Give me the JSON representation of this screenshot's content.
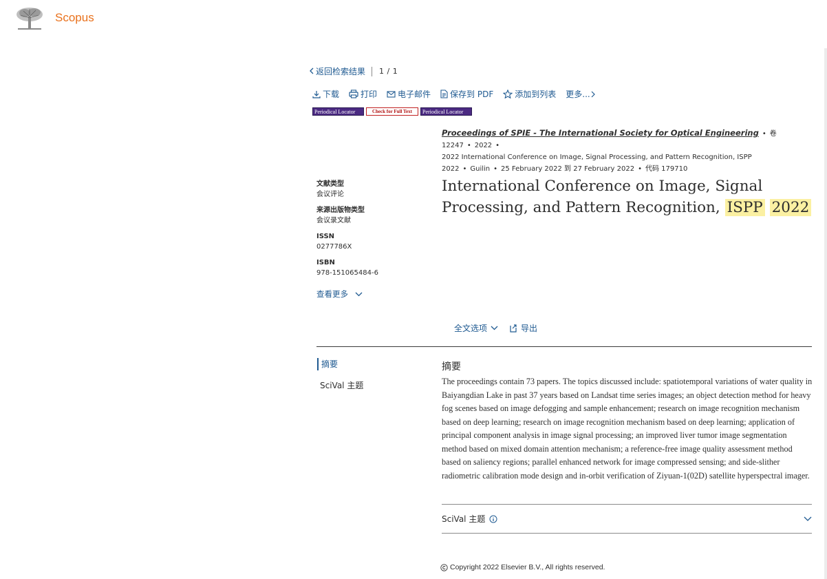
{
  "header": {
    "brand": "Scopus"
  },
  "nav": {
    "back": "返回检索结果",
    "pager": "1 / 1"
  },
  "toolbar": {
    "download": "下载",
    "print": "打印",
    "email": "电子邮件",
    "save_pdf": "保存到 PDF",
    "add_list": "添加到列表",
    "more": "更多..."
  },
  "badges": {
    "periodical_locator": "Periodical Locator",
    "check_full_text": "Check for Full Text"
  },
  "source": {
    "journal": "Proceedings of SPIE - The International Society for Optical Engineering",
    "volume": "卷 12247",
    "year": "2022",
    "conference": "2022 International Conference on Image, Signal Processing, and Pattern Recognition, ISPP 2022",
    "location": "Guilin",
    "dates": "25 February 2022 到 27 February 2022",
    "code": "代码 179710"
  },
  "title": {
    "main": "International Conference on Image, Signal Processing, and Pattern Recognition,",
    "hl1": "ISPP",
    "hl2": "2022"
  },
  "meta": {
    "doc_type_label": "文献类型",
    "doc_type": "会议评论",
    "source_type_label": "来源出版物类型",
    "source_type": "会议录文献",
    "issn_label": "ISSN",
    "issn": "0277786X",
    "isbn_label": "ISBN",
    "isbn": "978-151065484-6",
    "see_more": "查看更多"
  },
  "actions": {
    "full_text": "全文选项",
    "export": "导出"
  },
  "sidenav": {
    "abstract": "摘要",
    "scival": "SciVal 主题"
  },
  "abstract": {
    "heading": "摘要",
    "text": "The proceedings contain 73 papers. The topics discussed include: spatiotemporal variations of water quality in Baiyangdian Lake in past 37 years based on Landsat time series images; an object detection method for heavy fog scenes based on image defogging and sample enhancement; research on image recognition mechanism based on deep learning; research on image recognition mechanism based on deep learning; application of principal component analysis in image signal processing; an improved liver tumor image segmentation method based on mixed domain attention mechanism; a reference-free image quality assessment method based on saliency regions; parallel enhanced network for image compressed sensing; and side-slither radiometric calibration mode design and in-orbit verification of Ziyuan-1(02D) satellite hyperspectral imager."
  },
  "scival": {
    "label": "SciVal 主题"
  },
  "footer": {
    "copyright": "Copyright 2022 Elsevier B.V., All rights reserved."
  },
  "colors": {
    "brand": "#e9711c",
    "link": "#1f5a91",
    "highlight": "#fbf0a2"
  }
}
